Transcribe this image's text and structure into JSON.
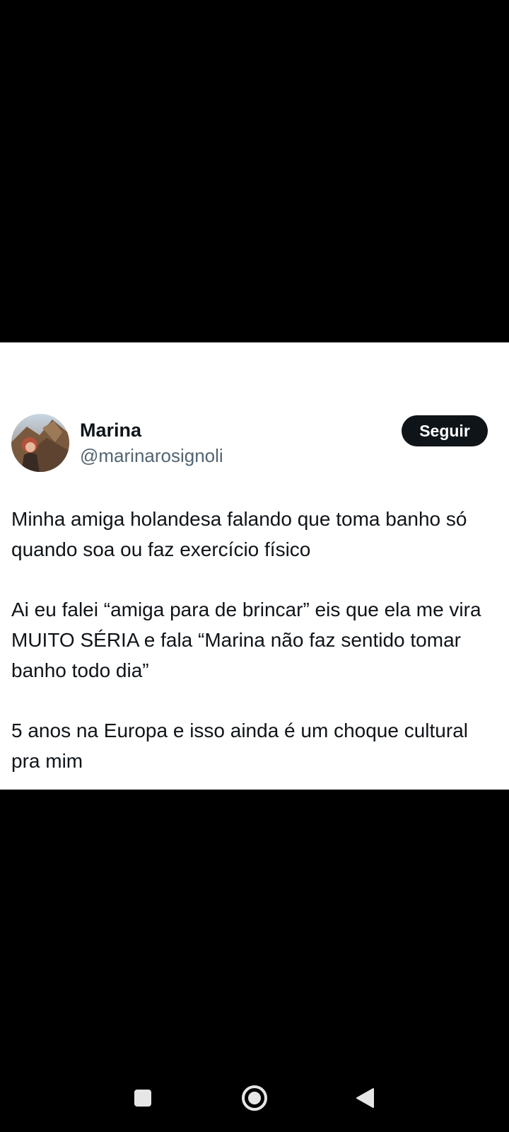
{
  "tweet": {
    "author": {
      "display_name": "Marina",
      "handle": "@marinarosignoli"
    },
    "follow_label": "Seguir",
    "paragraphs": [
      "Minha amiga holandesa falando que toma banho só quando soa ou faz exercício físico",
      "Ai eu falei “amiga para de brincar” eis que ela me vira MUITO SÉRIA e fala “Marina não faz sentido tomar banho todo dia”",
      "5 anos na Europa e isso ainda é um choque cultural pra mim"
    ]
  },
  "navbar": {
    "icons": [
      "recents-icon",
      "home-icon",
      "back-icon"
    ]
  },
  "colors": {
    "background": "#000000",
    "card": "#ffffff",
    "text_primary": "#0f1419",
    "text_secondary": "#536471",
    "button_bg": "#0f1419",
    "nav_icon": "#e6e6e6"
  }
}
